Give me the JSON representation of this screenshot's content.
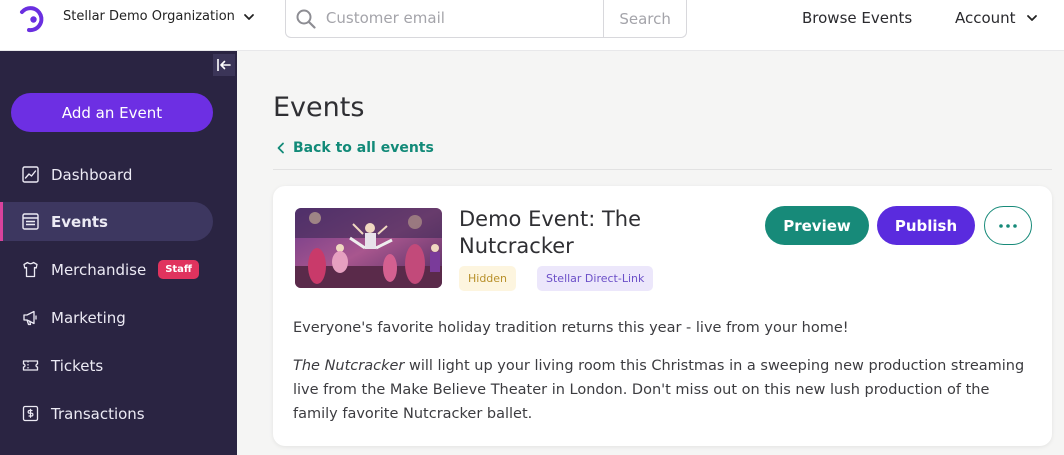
{
  "org": {
    "name": "Stellar Demo Organization"
  },
  "search": {
    "placeholder": "Customer email",
    "button_label": "Search"
  },
  "nav": {
    "browse_events": "Browse Events",
    "account": "Account"
  },
  "sidebar": {
    "add_event_label": "Add an Event",
    "items": [
      {
        "label": "Dashboard",
        "icon": "chart-icon"
      },
      {
        "label": "Events",
        "icon": "events-icon",
        "active": true
      },
      {
        "label": "Merchandise",
        "icon": "shirt-icon",
        "badge": "Staff"
      },
      {
        "label": "Marketing",
        "icon": "megaphone-icon"
      },
      {
        "label": "Tickets",
        "icon": "ticket-icon"
      },
      {
        "label": "Transactions",
        "icon": "receipt-icon"
      }
    ]
  },
  "main": {
    "page_title": "Events",
    "back_link": "Back to all events",
    "event": {
      "title": "Demo Event: The Nutcracker",
      "tags": [
        "Hidden",
        "Stellar Direct-Link"
      ],
      "preview_label": "Preview",
      "publish_label": "Publish",
      "description_1": "Everyone's favorite holiday tradition returns this year - live from your home!",
      "description_2_italic": "The Nutcracker",
      "description_2_rest": " will light up your living room this Christmas in a sweeping new production streaming live from the Make Believe Theater in London. Don't miss out on this new lush production of the family favorite Nutcracker ballet."
    }
  },
  "colors": {
    "sidebar_bg": "#2a2442",
    "accent_purple": "#6d2fe3",
    "accent_teal": "#178a79",
    "active_marker": "#d9429c",
    "staff_badge": "#e0335e"
  }
}
